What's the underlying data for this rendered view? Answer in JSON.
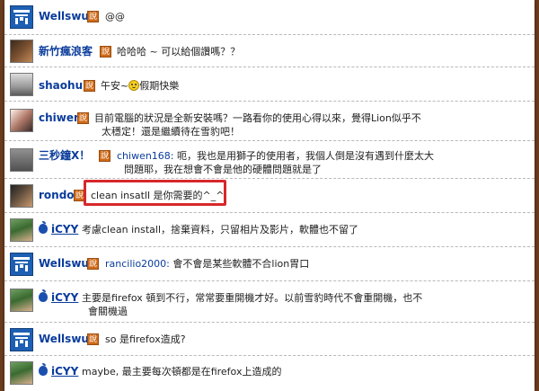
{
  "posts": [
    {
      "user": "Wellswu",
      "badge": "說",
      "message": "@@",
      "avatar_icon": "site-logo-icon"
    },
    {
      "user": "新竹瘋浪客",
      "badge": "說",
      "message": "哈哈哈 ~ 可以給個讚嗎？？",
      "avatar_icon": "user-photo-avatar"
    },
    {
      "user": "shaohu",
      "badge": "說",
      "message_before": "午安~",
      "message_after": "假期快樂",
      "emoticon": "smiley-icon",
      "avatar_icon": "user-photo-avatar"
    },
    {
      "user": "chiwen",
      "badge": "說",
      "message_line1": "目前電腦的狀況是全新安裝嗎？一路看你的使用心得以來，覺得Lion似乎不",
      "message_line2": "太穩定！還是繼續待在雪豹吧！",
      "avatar_icon": "user-photo-avatar"
    },
    {
      "user": "三秒鐘X！",
      "badge": "說",
      "reply_to": "chiwen168:",
      "message_line1": " 呃，我也是用獅子的使用者，我個人倒是沒有遇到什麼太大",
      "message_line2": "問題耶，我在想會不會是他的硬體問題就是了",
      "avatar_icon": "user-photo-avatar"
    },
    {
      "user": "rondo",
      "badge": "說",
      "message": "clean insatll 是你需要的^_^",
      "avatar_icon": "user-photo-avatar"
    },
    {
      "user": "iCYY",
      "badge": "說",
      "message": "考慮clean install，捨棄資料，只留相片及影片，軟體也不留了",
      "avatar_icon": "apple-icon"
    },
    {
      "user": "Wellswu",
      "badge": "說",
      "reply_to": "rancilio2000:",
      "message": " 會不會是某些軟體不合lion胃口",
      "avatar_icon": "site-logo-icon"
    },
    {
      "user": "iCYY",
      "badge": "說",
      "message_line1": "主要是firefox 頓到不行，常常要重開機才好。以前雪豹時代不會重開機，也不",
      "message_line2": "會關機過",
      "avatar_icon": "apple-icon"
    },
    {
      "user": "Wellswu",
      "badge": "說",
      "message": "so 是firefox造成?",
      "avatar_icon": "site-logo-icon"
    },
    {
      "user": "iCYY",
      "badge": "說",
      "message": "maybe, 最主要每次頓都是在firefox上造成的",
      "avatar_icon": "apple-icon"
    }
  ],
  "colors": {
    "username": "#0a3c9c",
    "badge": "#cf6a17",
    "highlight": "#d7272b",
    "background": "#6b3d1e"
  }
}
